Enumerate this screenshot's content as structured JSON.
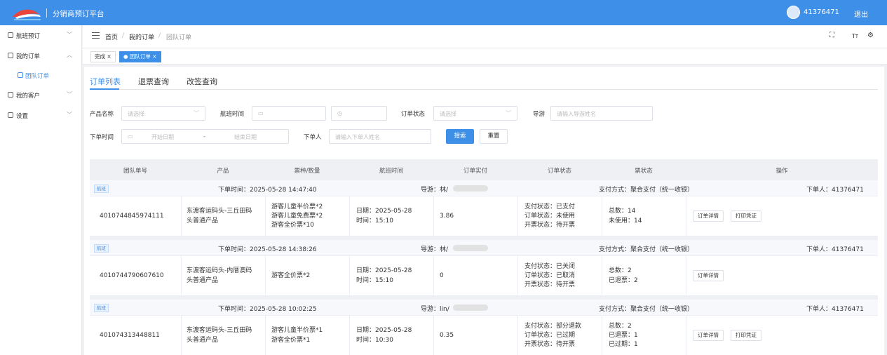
{
  "app": {
    "title": "分销商预订平台",
    "user_id": "41376471",
    "logout": "退出"
  },
  "sidebar": {
    "items": [
      {
        "label": "航班预订",
        "chevron": "﹀"
      },
      {
        "label": "我的订单",
        "chevron": "︿"
      },
      {
        "label": "团队订单",
        "chevron": ""
      },
      {
        "label": "我的客户",
        "chevron": "﹀"
      },
      {
        "label": "设置",
        "chevron": "﹀"
      }
    ]
  },
  "breadcrumb": {
    "home": "首页",
    "sep": "/",
    "orders": "我的订单",
    "current": "团队订单"
  },
  "tabs": [
    {
      "label": "完成 ×"
    },
    {
      "label": "● 团队订单 ×"
    }
  ],
  "subtabs": [
    "订单列表",
    "退票查询",
    "改签查询"
  ],
  "filters": {
    "product_label": "产品名称",
    "product_placeholder": "请选择",
    "flight_time_label": "航班时间",
    "status_label": "订单状态",
    "status_placeholder": "请选择",
    "guide_label": "导游",
    "guide_placeholder": "请输入导游姓名",
    "order_time_label": "下单时间",
    "start_placeholder": "开始日期",
    "range_sep": "-",
    "end_placeholder": "结束日期",
    "orderer_label": "下单人",
    "orderer_placeholder": "请输入下单人姓名",
    "search": "搜索",
    "reset": "重置"
  },
  "table": {
    "headers": [
      "团队单号",
      "产品",
      "票种/数量",
      "航班时间",
      "订单实付",
      "订单状态",
      "票状态",
      "操作"
    ],
    "groups": [
      {
        "badge": "航班",
        "order_time": "下单时间：2025-05-28 14:47:40",
        "guide": "导游：林/",
        "pay_method": "支付方式：聚合支付（统一收银）",
        "orderer": "下单人：41376471",
        "order_no": "4010744845974111",
        "product": [
          "东渡客运码头-三丘田码",
          "头普通产品"
        ],
        "tickets": [
          "游客儿童半价票*2",
          "游客儿童免费票*2",
          "游客全价票*10"
        ],
        "flight": [
          "日期：2025-05-28",
          "时间：15:10"
        ],
        "paid": "3.86",
        "status": [
          "支付状态：已支付",
          "订单状态：未使用",
          "开票状态：待开票"
        ],
        "ticket_status": [
          "总数：14",
          "未使用：14"
        ],
        "actions": [
          "订单详情",
          "打印凭证"
        ]
      },
      {
        "badge": "航班",
        "order_time": "下单时间：2025-05-28 14:38:26",
        "guide": "导游：林/",
        "pay_method": "支付方式：聚合支付（统一收银）",
        "orderer": "下单人：41376471",
        "order_no": "4010744790607610",
        "product": [
          "东渡客运码头-内厝澳码",
          "头普通产品"
        ],
        "tickets": [
          "游客全价票*2"
        ],
        "flight": [
          "日期：2025-05-28",
          "时间：15:10"
        ],
        "paid": "0",
        "status": [
          "支付状态：已关闭",
          "订单状态：已取消",
          "开票状态：待开票"
        ],
        "ticket_status": [
          "总数：2",
          "已退票：2"
        ],
        "actions": [
          "订单详情"
        ]
      },
      {
        "badge": "航班",
        "order_time": "下单时间：2025-05-28 10:02:25",
        "guide": "导游：lin/",
        "pay_method": "支付方式：聚合支付（统一收银）",
        "orderer": "下单人：41376471",
        "order_no": "401074313448811",
        "product": [
          "东渡客运码头-三丘田码",
          "头普通产品"
        ],
        "tickets": [
          "游客儿童半价票*1",
          "游客全价票*1"
        ],
        "flight": [
          "日期：2025-05-28",
          "时间：10:30"
        ],
        "paid": "0.35",
        "status": [
          "支付状态：部分退款",
          "订单状态：已过期",
          "开票状态：待开票"
        ],
        "ticket_status": [
          "总数：2",
          "已退票：1",
          "已过期：1"
        ],
        "actions": [
          "订单详情",
          "打印凭证"
        ]
      }
    ]
  },
  "colors": {
    "primary": "#3e8fe8",
    "header_bg": "#eef0f4"
  }
}
